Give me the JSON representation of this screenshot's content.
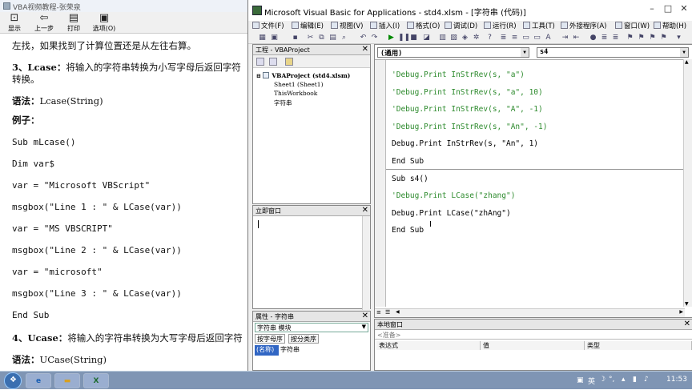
{
  "help": {
    "title": "VBA视频教程-张荣泉",
    "toolbar": [
      {
        "label": "显示",
        "icon": "show-icon"
      },
      {
        "label": "上一步",
        "icon": "back-arrow-icon"
      },
      {
        "label": "打印",
        "icon": "printer-icon"
      },
      {
        "label": "选项(O)",
        "icon": "options-icon"
      }
    ],
    "lines": [
      {
        "text": "左找，如果找到了计算位置还是从左往右算。",
        "style": ""
      },
      {
        "text": "3、Lcase：将输入的字符串转换为小写字母后返回字符",
        "style": "b-partial"
      },
      {
        "text": "转换。",
        "style": ""
      },
      {
        "text": "语法：Lcase(String)",
        "style": "b-partial"
      },
      {
        "text": "例子：",
        "style": "b"
      },
      {
        "text": "Sub mLcase()",
        "style": "m"
      },
      {
        "text": "Dim var$",
        "style": "m"
      },
      {
        "text": "var = \"Microsoft VBScript\"",
        "style": "m"
      },
      {
        "text": "msgbox(\"Line 1 : \" & LCase(var))",
        "style": "m"
      },
      {
        "text": "var = \"MS VBSCRIPT\"",
        "style": "m"
      },
      {
        "text": "msgbox(\"Line 2 : \" & LCase(var))",
        "style": "m"
      },
      {
        "text": "var = \"microsoft\"",
        "style": "m"
      },
      {
        "text": "msgbox(\"Line 3 : \" & LCase(var))",
        "style": "m"
      },
      {
        "text": "End Sub",
        "style": "m"
      },
      {
        "text": "4、Ucase：将输入的字符串转换为大写字母后返回字符",
        "style": "b-partial"
      },
      {
        "text": "语法：UCase(String)",
        "style": "b-partial"
      }
    ]
  },
  "vbe": {
    "title": "Microsoft Visual Basic for Applications - std4.xlsm - [字符串 (代码)]",
    "menu": [
      "文件(F)",
      "编辑(E)",
      "视图(V)",
      "插入(I)",
      "格式(O)",
      "调试(D)",
      "运行(R)",
      "工具(T)",
      "外接程序(A)",
      "窗口(W)",
      "帮助(H)"
    ],
    "project": {
      "title": "工程 - VBAProject",
      "root": "VBAProject (std4.xlsm)",
      "items": [
        "Sheet1 (Sheet1)",
        "ThisWorkbook",
        "字符串"
      ]
    },
    "immediate": {
      "title": "立即窗口"
    },
    "properties": {
      "title": "属性 - 字符串",
      "combo": "字符串 模块",
      "tabs": [
        "按字母序",
        "按分类序"
      ],
      "row_name": "(名称)",
      "row_value": "字符串"
    },
    "code": {
      "object_combo": "(通用)",
      "proc_combo": "s4",
      "lines": [
        {
          "text": "'Debug.Print InStrRev(s, \"a\")",
          "type": "comment"
        },
        {
          "text": "'Debug.Print InStrRev(s, \"a\", 10)",
          "type": "comment"
        },
        {
          "text": "'Debug.Print InStrRev(s, \"A\", -1)",
          "type": "comment"
        },
        {
          "text": "'Debug.Print InStrRev(s, \"An\", -1)",
          "type": "comment"
        },
        {
          "text": "Debug.Print InStrRev(s, \"An\", 1)",
          "type": "code"
        },
        {
          "text": "End Sub",
          "type": "code"
        },
        {
          "text": "Sub s4()",
          "type": "code"
        },
        {
          "text": "'Debug.Print LCase(\"zhang\")",
          "type": "comment"
        },
        {
          "text": "Debug.Print LCase(\"zhAng\")",
          "type": "code"
        },
        {
          "text": "End Sub",
          "type": "code"
        }
      ]
    },
    "locals": {
      "title": "本地窗口",
      "state": "<准备>",
      "columns": [
        "表达式",
        "值",
        "类型"
      ]
    }
  },
  "taskbar": {
    "apps": [
      "ie-icon",
      "folder-icon",
      "excel-icon"
    ],
    "tray_lang": "英",
    "clock": "11:53"
  }
}
